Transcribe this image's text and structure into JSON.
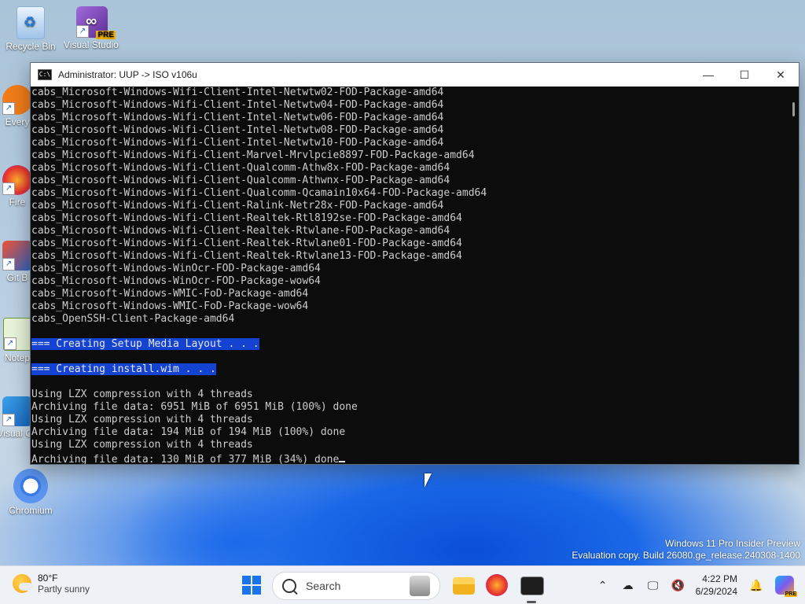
{
  "desktop": {
    "icons": [
      {
        "label": "Recycle Bin"
      },
      {
        "label": "Visual Studio 2022 P...",
        "badge": "PRE"
      },
      {
        "label": "Every"
      },
      {
        "label": "Fire"
      },
      {
        "label": "Git B"
      },
      {
        "label": "Notep"
      },
      {
        "label": "Visual Co"
      },
      {
        "label": "Chromium"
      }
    ]
  },
  "window": {
    "title": "Administrator:  UUP -> ISO v106u",
    "app_icon": "C:\\",
    "minimize": "—",
    "maximize": "☐",
    "close": "✕"
  },
  "console_lines": [
    {
      "text": "cabs_Microsoft-Windows-Wifi-Client-Intel-Netwtw02-FOD-Package-amd64"
    },
    {
      "text": "cabs_Microsoft-Windows-Wifi-Client-Intel-Netwtw04-FOD-Package-amd64"
    },
    {
      "text": "cabs_Microsoft-Windows-Wifi-Client-Intel-Netwtw06-FOD-Package-amd64"
    },
    {
      "text": "cabs_Microsoft-Windows-Wifi-Client-Intel-Netwtw08-FOD-Package-amd64"
    },
    {
      "text": "cabs_Microsoft-Windows-Wifi-Client-Intel-Netwtw10-FOD-Package-amd64"
    },
    {
      "text": "cabs_Microsoft-Windows-Wifi-Client-Marvel-Mrvlpcie8897-FOD-Package-amd64"
    },
    {
      "text": "cabs_Microsoft-Windows-Wifi-Client-Qualcomm-Athw8x-FOD-Package-amd64"
    },
    {
      "text": "cabs_Microsoft-Windows-Wifi-Client-Qualcomm-Athwnx-FOD-Package-amd64"
    },
    {
      "text": "cabs_Microsoft-Windows-Wifi-Client-Qualcomm-Qcamain10x64-FOD-Package-amd64"
    },
    {
      "text": "cabs_Microsoft-Windows-Wifi-Client-Ralink-Netr28x-FOD-Package-amd64"
    },
    {
      "text": "cabs_Microsoft-Windows-Wifi-Client-Realtek-Rtl8192se-FOD-Package-amd64"
    },
    {
      "text": "cabs_Microsoft-Windows-Wifi-Client-Realtek-Rtwlane-FOD-Package-amd64"
    },
    {
      "text": "cabs_Microsoft-Windows-Wifi-Client-Realtek-Rtwlane01-FOD-Package-amd64"
    },
    {
      "text": "cabs_Microsoft-Windows-Wifi-Client-Realtek-Rtwlane13-FOD-Package-amd64"
    },
    {
      "text": "cabs_Microsoft-Windows-WinOcr-FOD-Package-amd64"
    },
    {
      "text": "cabs_Microsoft-Windows-WinOcr-FOD-Package-wow64"
    },
    {
      "text": "cabs_Microsoft-Windows-WMIC-FoD-Package-amd64"
    },
    {
      "text": "cabs_Microsoft-Windows-WMIC-FoD-Package-wow64"
    },
    {
      "text": "cabs_OpenSSH-Client-Package-amd64"
    },
    {
      "text": ""
    },
    {
      "text": "=== Creating Setup Media Layout . . .",
      "highlight": true
    },
    {
      "text": ""
    },
    {
      "text": "=== Creating install.wim . . .",
      "highlight": true
    },
    {
      "text": ""
    },
    {
      "text": "Using LZX compression with 4 threads"
    },
    {
      "text": "Archiving file data: 6951 MiB of 6951 MiB (100%) done"
    },
    {
      "text": "Using LZX compression with 4 threads"
    },
    {
      "text": "Archiving file data: 194 MiB of 194 MiB (100%) done"
    },
    {
      "text": "Using LZX compression with 4 threads"
    },
    {
      "text": "Archiving file data: 130 MiB of 377 MiB (34%) done",
      "cursor": true
    }
  ],
  "watermark": {
    "line1": "Windows 11 Pro Insider Preview",
    "line2": "Evaluation copy. Build 26080.ge_release.240308-1400"
  },
  "taskbar": {
    "weather_temp": "80°F",
    "weather_desc": "Partly sunny",
    "search_placeholder": "Search",
    "clock_time": "4:22 PM",
    "clock_date": "6/29/2024",
    "copilot_badge": "PRE"
  }
}
